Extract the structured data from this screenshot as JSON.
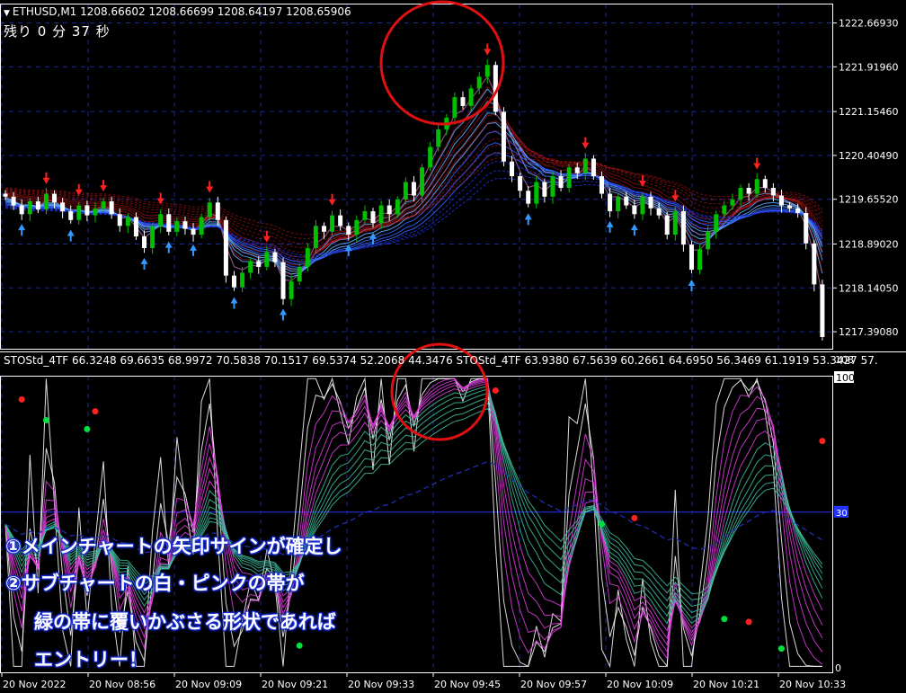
{
  "header": {
    "symbol_line": "ETHUSD,M1  1208.66602 1208.66699 1208.64197 1208.65906",
    "countdown": "残り 0 分 37 秒"
  },
  "oscillator": {
    "header": "STOStd_4TF 66.3248 69.6635 68.9972 70.5838 70.1517 69.5374 52.2068 44.3476  STOStd_4TF 63.9380 67.5639 60.2661 64.6950 56.3469 61.1919 53.3427 57.",
    "axis_labels": [
      "108",
      "100",
      "30",
      "0"
    ]
  },
  "price_axis_labels": [
    "1222.66930",
    "1221.91960",
    "1221.15460",
    "1220.40490",
    "1219.65520",
    "1218.89020",
    "1218.14050",
    "1217.39080"
  ],
  "time_axis_labels": [
    "20 Nov 2022",
    "20 Nov 08:56",
    "20 Nov 09:09",
    "20 Nov 09:21",
    "20 Nov 09:33",
    "20 Nov 09:45",
    "20 Nov 09:57",
    "20 Nov 10:09",
    "20 Nov 10:21",
    "20 Nov 10:33"
  ],
  "annotations": [
    "①メインチャートの矢印サインが確定し",
    "②サブチャートの白・ピンクの帯が",
    "緑の帯に覆いかぶさる形状であれば",
    "エントリー！"
  ],
  "colors": {
    "background": "#000000",
    "bull_candle": "#00c000",
    "bear_candle": "#ffffff",
    "sell_arrow": "#ff2020",
    "buy_arrow": "#3399ff",
    "highlight_circle": "#e01010",
    "osc_white": "#ffffff",
    "osc_pink": "#e040e0",
    "osc_green": "#40c0a0",
    "annotation_outline": "#1a2fd0"
  },
  "chart_data": {
    "type": "candlestick",
    "symbol": "ETHUSD",
    "timeframe": "M1",
    "ohlc_last": {
      "open": 1208.66602,
      "high": 1208.66699,
      "low": 1208.64197,
      "close": 1208.65906
    },
    "ylim": [
      1217.1,
      1223.0
    ],
    "osc_ylim": [
      0,
      100
    ],
    "osc_level": 30,
    "price_close": [
      1219.7,
      1219.55,
      1219.4,
      1219.62,
      1219.48,
      1219.75,
      1219.6,
      1219.45,
      1219.3,
      1219.55,
      1219.38,
      1219.5,
      1219.62,
      1219.4,
      1219.2,
      1219.35,
      1219.02,
      1218.82,
      1219.2,
      1219.4,
      1219.1,
      1219.28,
      1219.15,
      1219.05,
      1219.35,
      1219.6,
      1219.3,
      1218.35,
      1218.15,
      1218.4,
      1218.6,
      1218.5,
      1218.75,
      1218.58,
      1217.95,
      1218.25,
      1218.5,
      1218.82,
      1219.2,
      1219.1,
      1219.38,
      1219.2,
      1219.05,
      1219.3,
      1219.45,
      1219.25,
      1219.55,
      1219.4,
      1219.65,
      1219.95,
      1219.72,
      1220.2,
      1220.55,
      1220.85,
      1221.05,
      1221.4,
      1221.25,
      1221.55,
      1221.75,
      1221.95,
      1221.15,
      1220.3,
      1220.05,
      1219.8,
      1219.58,
      1219.95,
      1219.7,
      1220.05,
      1219.85,
      1220.2,
      1220.1,
      1220.35,
      1220.05,
      1219.75,
      1219.45,
      1219.7,
      1219.55,
      1219.4,
      1219.7,
      1219.5,
      1219.38,
      1219.05,
      1219.45,
      1218.88,
      1218.45,
      1218.8,
      1219.1,
      1219.4,
      1219.55,
      1219.65,
      1219.85,
      1219.75,
      1220.0,
      1219.85,
      1219.72,
      1219.55,
      1219.5,
      1219.42,
      1218.9,
      1218.2,
      1217.3
    ]
  }
}
